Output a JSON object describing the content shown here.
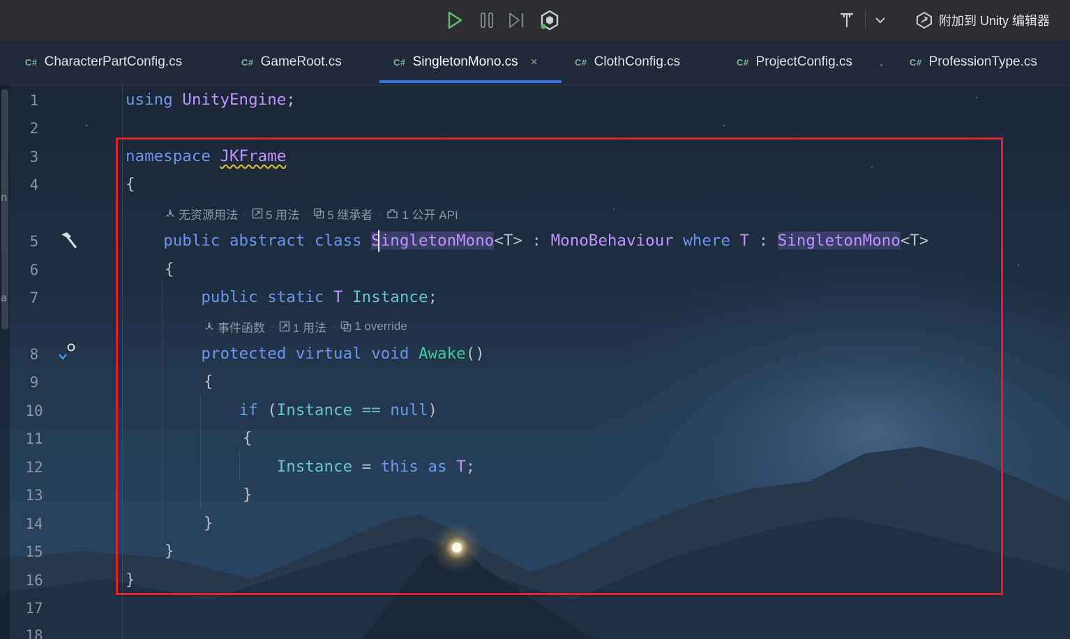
{
  "toolbar": {
    "attach_label": "附加到 Unity 编辑器",
    "icons": [
      "play-icon",
      "pause-icon",
      "step-icon",
      "unity-debug-icon",
      "text-format-icon",
      "chevron-down-icon",
      "unity-logo-icon"
    ]
  },
  "tabs": [
    {
      "lang": "C#",
      "label": "CharacterPartConfig.cs"
    },
    {
      "lang": "C#",
      "label": "GameRoot.cs"
    },
    {
      "lang": "C#",
      "label": "SingletonMono.cs",
      "active": true,
      "close": "×"
    },
    {
      "lang": "C#",
      "label": "ClothConfig.cs"
    },
    {
      "lang": "C#",
      "label": "ProjectConfig.cs"
    },
    {
      "lang": "C#",
      "label": "ProfessionType.cs"
    }
  ],
  "left_strip": {
    "letters": [
      "n",
      "a"
    ]
  },
  "editor": {
    "line_numbers": [
      "1",
      "2",
      "3",
      "4",
      "5",
      "6",
      "7",
      "8",
      "9",
      "10",
      "11",
      "12",
      "13",
      "14",
      "15",
      "16",
      "17",
      "18"
    ],
    "code": {
      "l1": {
        "kw": "using",
        "name": "UnityEngine",
        "punct": ";"
      },
      "l3": {
        "kw": "namespace",
        "name": "JKFrame"
      },
      "l4": "{",
      "l5": {
        "public": "public",
        "abstract": "abstract",
        "class": "class",
        "name": "SingletonMono",
        "tparam": "<T>",
        "colon": " : ",
        "base": "MonoBehaviour",
        "where": "where",
        "t": "T",
        "colon2": " : ",
        "constraint": "SingletonMono",
        "tparam2": "<T>"
      },
      "l6": "{",
      "l7": {
        "public": "public",
        "static": "static",
        "t": "T",
        "field": "Instance",
        "punct": ";"
      },
      "l8": {
        "protected": "protected",
        "virtual": "virtual",
        "void": "void",
        "method": "Awake",
        "parens": "()"
      },
      "l9": "{",
      "l10": {
        "if": "if",
        "open": " (",
        "field": "Instance",
        "eq": "==",
        "null": "null",
        "close": ")"
      },
      "l11": "{",
      "l12": {
        "field": "Instance",
        "assign": " = ",
        "this": "this",
        "as": "as",
        "t": "T",
        "punct": ";"
      },
      "l13": "}",
      "l14": "}",
      "l15": "}",
      "l16": "}"
    },
    "inlay_class": [
      "无资源用法",
      "5 用法",
      "5 继承者",
      "1 公开 API"
    ],
    "inlay_method": [
      "事件函数",
      "1 用法",
      "1 override"
    ]
  }
}
